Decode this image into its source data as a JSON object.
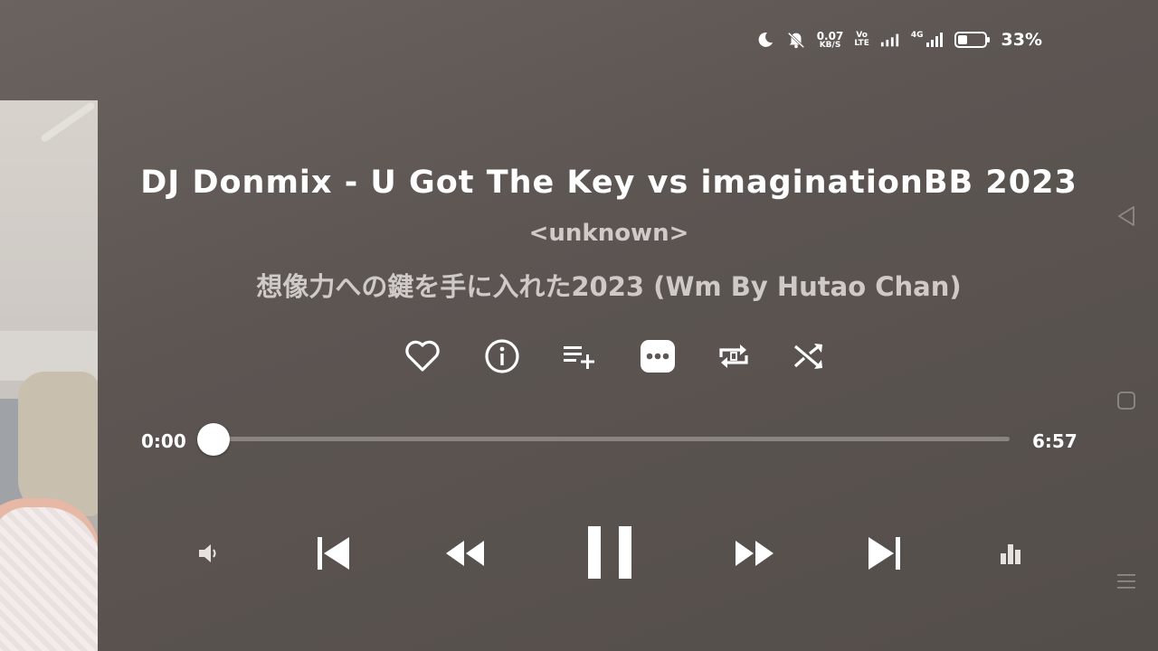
{
  "status_bar": {
    "speed_value": "0.07",
    "speed_unit": "KB/S",
    "volte_top": "Vo",
    "volte_bottom": "LTE",
    "network": "4G",
    "battery_percent": "33%"
  },
  "track": {
    "title": "DJ Donmix - U Got The Key vs imaginationBB 2023",
    "artist": "<unknown>",
    "album": "想像力への鍵を手に入れた2023 (Wm By Hutao Chan)"
  },
  "progress": {
    "current_time": "0:00",
    "total_time": "6:57",
    "fraction": 0.0
  },
  "actions": [
    "heart-icon",
    "info-icon",
    "add-to-playlist-icon",
    "more-icon",
    "repeat-one-icon",
    "shuffle-icon"
  ],
  "colors": {
    "background": "#5e5754",
    "accent": "#ffffff",
    "track": "#8a8481"
  }
}
